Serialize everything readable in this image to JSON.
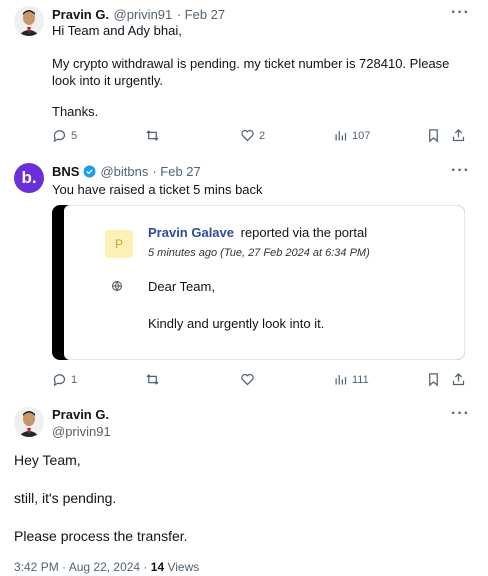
{
  "tweet1": {
    "name": "Pravin G.",
    "handle": "@privin91",
    "date": "· Feb 27",
    "line1": "Hi Team and Ady bhai,",
    "line2": "My crypto withdrawal is pending. my ticket number is 728410. Please look into it urgently.",
    "line3": "Thanks.",
    "replies": "5",
    "likes": "2",
    "views": "107"
  },
  "tweet2": {
    "name": "BNS",
    "handle": "@bitbns",
    "date": "· Feb 27",
    "avatar_letter": "b.",
    "text": "You have raised a ticket 5 mins back",
    "card": {
      "p_letter": "P",
      "author": "Pravin Galave",
      "reported": "reported via the portal",
      "time": "5 minutes ago (Tue, 27 Feb 2024 at 6:34 PM)",
      "greeting": "Dear Team,",
      "message": "Kindly and urgently look into it."
    },
    "replies": "1",
    "views": "111"
  },
  "tweet3": {
    "name": "Pravin G.",
    "handle": "@privin91",
    "line1": "Hey Team,",
    "line2": "still, it's pending.",
    "line3": "Please process the transfer.",
    "timestamp": "3:42 PM · Aug 22, 2024 ·",
    "views_count": "14",
    "views_label": "Views"
  },
  "more_label": "···",
  "colors": {
    "text": "#0f1419",
    "muted": "#536471",
    "verified": "#1d9bf0",
    "bns_purple": "#6a2fd6",
    "link": "#2e4aa0"
  }
}
